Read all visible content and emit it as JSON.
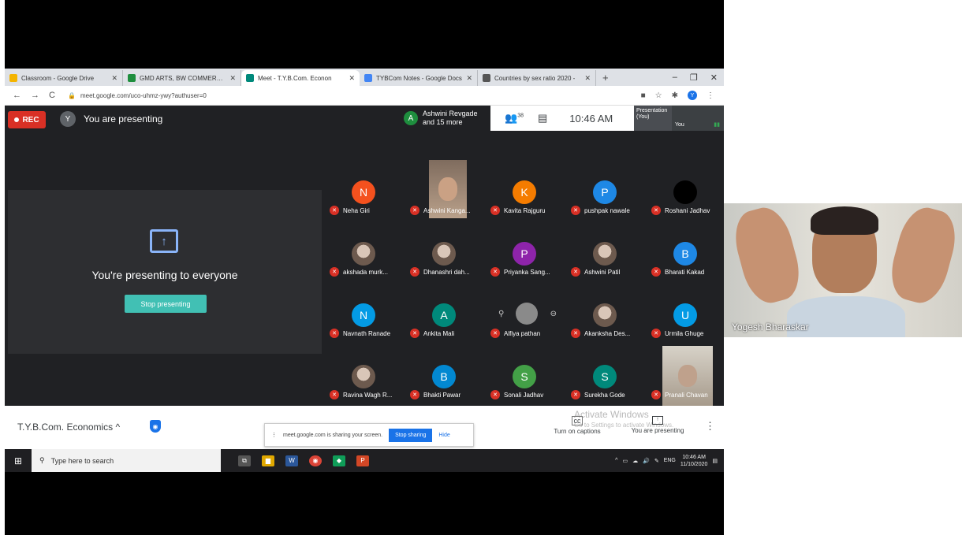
{
  "browser": {
    "tabs": [
      {
        "label": "Classroom - Google Drive",
        "color": "#f4b400",
        "active": false
      },
      {
        "label": "GMD ARTS, BW COMMERCE &",
        "color": "#1e8e3e",
        "active": false
      },
      {
        "label": "Meet - T.Y.B.Com. Econon",
        "color": "#00897b",
        "active": true
      },
      {
        "label": "TYBCom Notes - Google Docs",
        "color": "#4285f4",
        "active": false
      },
      {
        "label": "Countries by sex ratio 2020 -",
        "color": "#555555",
        "active": false
      }
    ],
    "url": "meet.google.com/uco-uhmz-ywy?authuser=0",
    "profile_initial": "Y"
  },
  "meet": {
    "rec_label": "REC",
    "user_initial": "Y",
    "presenting_label": "You are presenting",
    "joined_initial": "A",
    "joined_line1": "Ashwini Revgade",
    "joined_line2": "and 15 more",
    "people_count": "38",
    "time": "10:46 AM",
    "mini_presentation": "Presentation (You)",
    "mini_you": "You",
    "presenting_text": "You're presenting to everyone",
    "stop_presenting": "Stop presenting"
  },
  "participants": [
    {
      "name": "Neha Giri",
      "initial": "N",
      "color": "#f4511e",
      "kind": "initial"
    },
    {
      "name": "Ashwini Kanga...",
      "initial": "",
      "color": "#7f6c5e",
      "kind": "video"
    },
    {
      "name": "Kavita Rajguru",
      "initial": "K",
      "color": "#f57c00",
      "kind": "initial"
    },
    {
      "name": "pushpak nawale",
      "initial": "P",
      "color": "#1e88e5",
      "kind": "initial"
    },
    {
      "name": "Roshani Jadhav",
      "initial": "",
      "color": "#000000",
      "kind": "initial"
    },
    {
      "name": "akshada murk...",
      "initial": "",
      "color": "#888888",
      "kind": "photo"
    },
    {
      "name": "Dhanashri dah...",
      "initial": "",
      "color": "#c0392b",
      "kind": "photo"
    },
    {
      "name": "Priyanka Sang...",
      "initial": "P",
      "color": "#8e24aa",
      "kind": "initial"
    },
    {
      "name": "Ashwini Patil",
      "initial": "",
      "color": "#9e9e9e",
      "kind": "photo"
    },
    {
      "name": "Bharati Kakad",
      "initial": "B",
      "color": "#1e88e5",
      "kind": "initial"
    },
    {
      "name": "Navnath Ranade",
      "initial": "N",
      "color": "#039be5",
      "kind": "initial"
    },
    {
      "name": "Ankita Mali",
      "initial": "A",
      "color": "#00897b",
      "kind": "initial"
    },
    {
      "name": "Alfiya pathan",
      "initial": "",
      "color": "#777777",
      "kind": "hover"
    },
    {
      "name": "Akanksha Des...",
      "initial": "",
      "color": "#2b1f4a",
      "kind": "photo"
    },
    {
      "name": "Urmila Ghuge",
      "initial": "U",
      "color": "#039be5",
      "kind": "initial"
    },
    {
      "name": "Ravina Wagh R...",
      "initial": "",
      "color": "#c9a27e",
      "kind": "photo"
    },
    {
      "name": "Bhakti Pawar",
      "initial": "B",
      "color": "#0288d1",
      "kind": "initial"
    },
    {
      "name": "Sonali Jadhav",
      "initial": "S",
      "color": "#43a047",
      "kind": "initial"
    },
    {
      "name": "Surekha Gode",
      "initial": "S",
      "color": "#00897b",
      "kind": "initial"
    },
    {
      "name": "Pranali Chavan",
      "initial": "",
      "color": "#d7d2c8",
      "kind": "videor"
    }
  ],
  "bottombar": {
    "meeting_name": "T.Y.B.Com. Economics",
    "share_notice": "meet.google.com is sharing your screen.",
    "stop_sharing": "Stop sharing",
    "hide": "Hide",
    "captions": "Turn on captions",
    "you_presenting": "You are presenting",
    "activate_title": "Activate Windows",
    "activate_sub": "Go to Settings to activate Windows."
  },
  "taskbar": {
    "search_placeholder": "Type here to search",
    "lang": "ENG",
    "clock_time": "10:46 AM",
    "clock_date": "11/10/2020"
  },
  "presenter": {
    "name": "Yogesh Bharaskar"
  },
  "colors": {
    "meet_bg": "#202124",
    "rec_red": "#d93025",
    "stop_teal": "#41c0b4",
    "blue": "#1a73e8"
  }
}
